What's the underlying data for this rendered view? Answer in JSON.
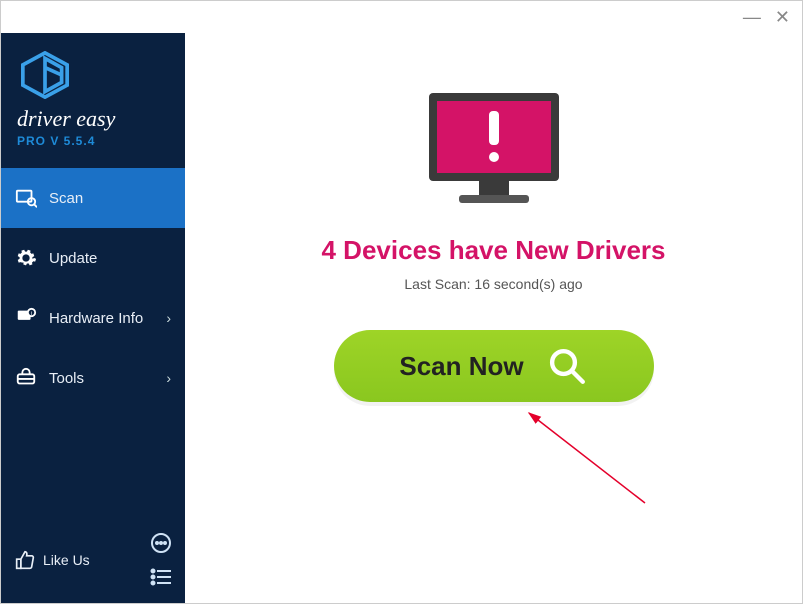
{
  "app": {
    "name": "driver easy",
    "version_label": "PRO V 5.5.4"
  },
  "sidebar": {
    "items": [
      {
        "label": "Scan",
        "has_chevron": false
      },
      {
        "label": "Update",
        "has_chevron": false
      },
      {
        "label": "Hardware Info",
        "has_chevron": true
      },
      {
        "label": "Tools",
        "has_chevron": true
      }
    ],
    "like_label": "Like Us"
  },
  "main": {
    "status_text": "4 Devices have New Drivers",
    "last_scan_text": "Last Scan: 16 second(s) ago",
    "scan_button_label": "Scan Now"
  },
  "colors": {
    "accent": "#1b71c6",
    "status": "#d41367",
    "button": "#8ec924"
  }
}
